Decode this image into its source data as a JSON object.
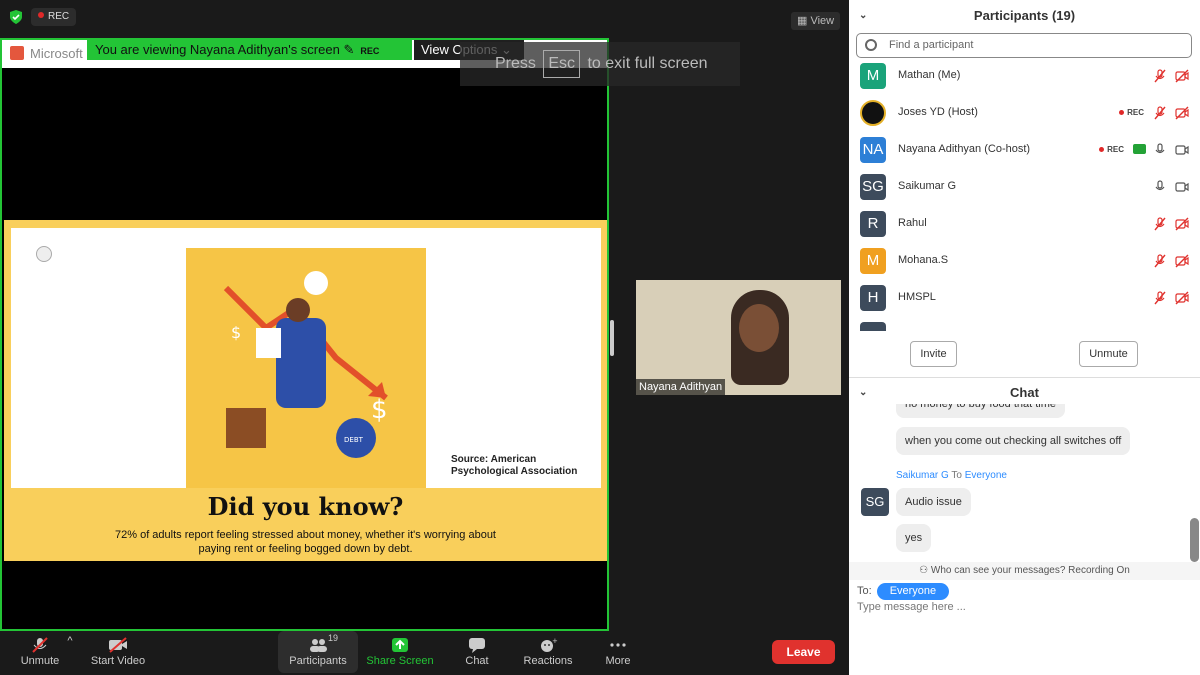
{
  "topbar": {
    "rec_label": "REC",
    "view_label": "View"
  },
  "share": {
    "app_name": "Microsoft",
    "banner_text": "You are viewing Nayana Adithyan's screen",
    "banner_rec": "REC",
    "view_options_label": "View Options",
    "esc_prefix": "Press",
    "esc_key": "Esc",
    "esc_suffix": "to exit full screen"
  },
  "slide": {
    "source_line1": "Source: American",
    "source_line2": "Psychological Association",
    "heading": "Did you know?",
    "stat_line1": "72% of adults report feeling stressed  about money, whether it's worrying about",
    "stat_line2": "paying rent or feeling bogged down by debt.",
    "art_badge": "DEBT"
  },
  "camera_tile": {
    "name": "Nayana Adithyan"
  },
  "toolbar": {
    "unmute": "Unmute",
    "start_video": "Start Video",
    "participants": "Participants",
    "participants_count": "19",
    "share_screen": "Share Screen",
    "chat": "Chat",
    "reactions": "Reactions",
    "more": "More",
    "leave": "Leave"
  },
  "participants_panel": {
    "title": "Participants (19)",
    "search_placeholder": "Find a participant",
    "invite": "Invite",
    "unmute": "Unmute",
    "rows": [
      {
        "initials": "M",
        "name": "Mathan (Me)",
        "color": "#1aa37a",
        "rec": "",
        "share": false,
        "mic": "muted",
        "cam": "off"
      },
      {
        "initials": "",
        "name": "Joses YD (Host)",
        "color": "#111111",
        "rec": "REC",
        "share": false,
        "mic": "muted",
        "cam": "off"
      },
      {
        "initials": "NA",
        "name": "Nayana Adithyan (Co-host)",
        "color": "#2d7fd6",
        "rec": "REC",
        "share": true,
        "mic": "on",
        "cam": "on"
      },
      {
        "initials": "SG",
        "name": "Saikumar G",
        "color": "#3d4b5c",
        "rec": "",
        "share": false,
        "mic": "on",
        "cam": "on"
      },
      {
        "initials": "R",
        "name": "Rahul",
        "color": "#3d4b5c",
        "rec": "",
        "share": false,
        "mic": "muted",
        "cam": "off"
      },
      {
        "initials": "M",
        "name": "Mohana.S",
        "color": "#f0a020",
        "rec": "",
        "share": false,
        "mic": "muted",
        "cam": "off"
      },
      {
        "initials": "H",
        "name": "HMSPL",
        "color": "#3d4b5c",
        "rec": "",
        "share": false,
        "mic": "muted",
        "cam": "off"
      }
    ]
  },
  "chat_panel": {
    "title": "Chat",
    "msg_partial": "no money to buy food that time",
    "msg1": "when you come out checking all switches off",
    "sender_name": "Saikumar G",
    "sender_to": "To",
    "sender_target": "Everyone",
    "sender_initials": "SG",
    "msg2": "Audio issue",
    "msg3": "yes",
    "privacy": "Who can see your messages? Recording On",
    "to_label": "To:",
    "to_target": "Everyone",
    "input_placeholder": "Type message here ..."
  },
  "colors": {
    "accent_green": "#23c436",
    "leave_red": "#e0322e",
    "link_blue": "#2d8cff"
  }
}
